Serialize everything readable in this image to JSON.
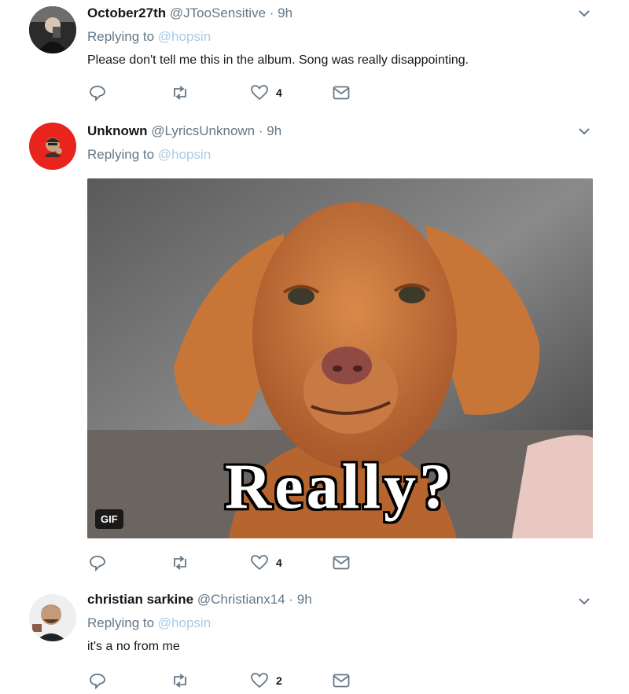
{
  "tweets": [
    {
      "name": "October27th",
      "handle": "@JTooSensitive",
      "dot": "·",
      "time": "9h",
      "reply_prefix": "Replying to",
      "reply_to": "@hopsin",
      "text": "Please don't tell me this in the album. Song was really disappointing.",
      "likes": "4"
    },
    {
      "name": "Unknown",
      "handle": "@LyricsUnknown",
      "dot": "·",
      "time": "9h",
      "reply_prefix": "Replying to",
      "reply_to": "@hopsin",
      "media": {
        "gif_label": "GIF",
        "caption": "Really?"
      },
      "likes": "4"
    },
    {
      "name": "christian sarkine",
      "handle": "@Christianx14",
      "dot": "·",
      "time": "9h",
      "reply_prefix": "Replying to",
      "reply_to": "@hopsin",
      "text": "it's a no from me",
      "likes": "2"
    }
  ],
  "colors": {
    "icon_gray": "#657786",
    "mention_blue": "#a8cbe6",
    "avatar2_red": "#e8241c"
  }
}
